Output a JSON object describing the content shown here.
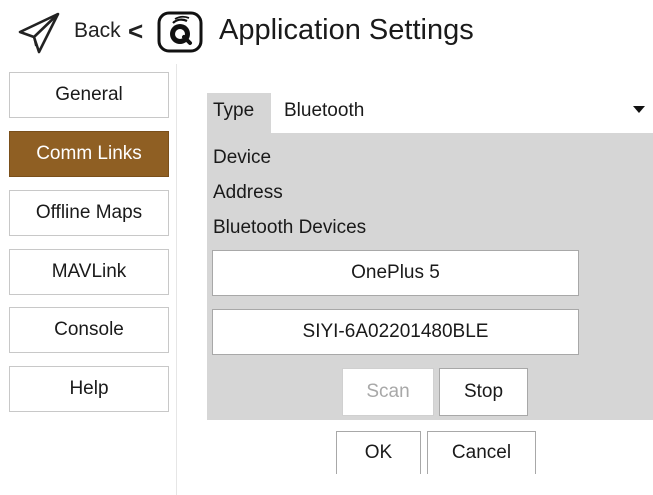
{
  "header": {
    "back_label": "Back",
    "back_caret": "<",
    "title": "Application Settings",
    "icons": [
      "paper-plane-icon",
      "app-logo-icon"
    ]
  },
  "sidebar": {
    "items": [
      {
        "label": "General",
        "active": false
      },
      {
        "label": "Comm Links",
        "active": true
      },
      {
        "label": "Offline Maps",
        "active": false
      },
      {
        "label": "MAVLink",
        "active": false
      },
      {
        "label": "Console",
        "active": false
      },
      {
        "label": "Help",
        "active": false
      }
    ]
  },
  "link_settings": {
    "type_label": "Type",
    "type_value": "Bluetooth",
    "device_label": "Device",
    "address_label": "Address",
    "devices_label": "Bluetooth Devices",
    "devices": [
      "OnePlus 5",
      "SIYI-6A02201480BLE"
    ],
    "scan_label": "Scan",
    "scan_enabled": false,
    "stop_label": "Stop"
  },
  "dialog": {
    "ok_label": "OK",
    "cancel_label": "Cancel"
  },
  "colors": {
    "accent": "#8f5f23",
    "panel_bg": "#d6d6d6"
  }
}
